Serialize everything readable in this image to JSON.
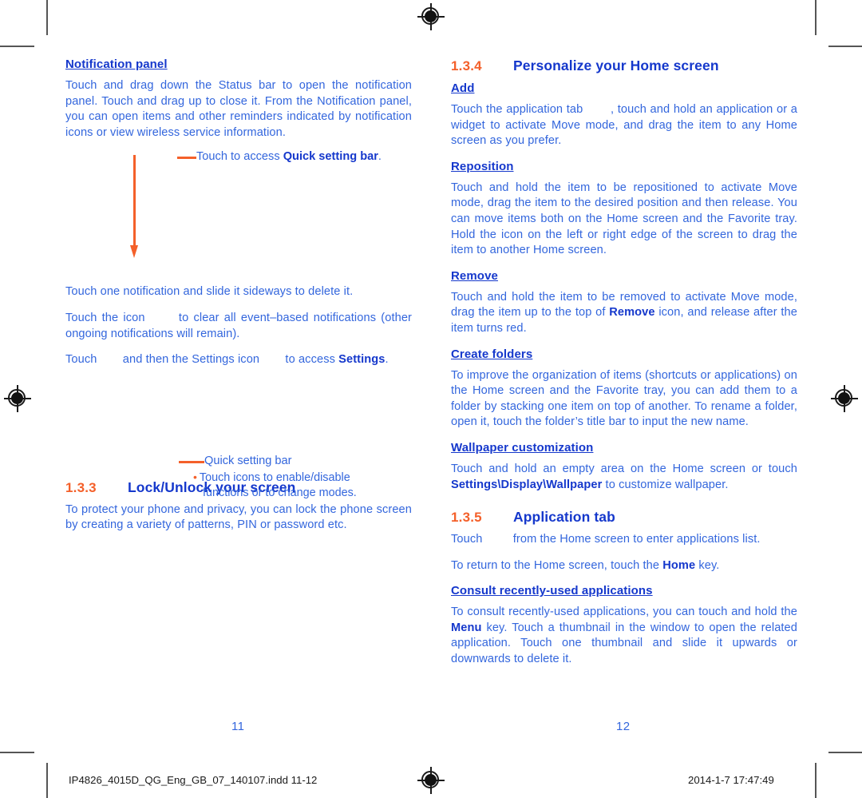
{
  "document": {
    "left_page_number": "11",
    "right_page_number": "12",
    "colors": {
      "body_blue": "#3366dd",
      "heading_blue": "#1538cc",
      "accent_orange": "#f4602a",
      "slug_black": "#1a1a1a"
    }
  },
  "left_column": {
    "notification_panel": {
      "heading": "Notification panel",
      "paragraph": "Touch and drag down the Status bar to open the notification panel. Touch and drag up to close it. From the Notification panel, you can open items and other reminders indicated by notification icons or view wireless service information."
    },
    "callout_quick_setting": {
      "text_before": "Touch to access ",
      "text_bold": "Quick setting bar",
      "text_after": "."
    },
    "paragraphs": {
      "delete_notification": "Touch one notification and slide it sideways to delete it.",
      "clear_events_before": "Touch the icon ",
      "clear_events_after": " to clear all event–based notifications (other ongoing notifications will remain).",
      "settings_before": "Touch ",
      "settings_middle": " and then the Settings icon ",
      "settings_after": " to access ",
      "settings_bold": "Settings",
      "settings_end": "."
    },
    "callout_quick_setting_bar": {
      "title": "Quick setting bar",
      "bullet": "•",
      "bullet_line_1": "Touch icons to enable/disable",
      "bullet_line_2": "functions or to change modes."
    },
    "section_lock": {
      "number": "1.3.3",
      "title": "Lock/Unlock your screen",
      "paragraph": "To protect your phone and privacy, you can lock the phone screen by creating a variety of patterns, PIN or password etc."
    }
  },
  "right_column": {
    "section_personalize": {
      "number": "1.3.4",
      "title": "Personalize your Home screen"
    },
    "add": {
      "heading": "Add",
      "text_before": "Touch the application tab ",
      "text_after": ", touch and hold an application or a widget to activate Move mode, and drag the item to any Home screen as you prefer."
    },
    "reposition": {
      "heading": "Reposition",
      "paragraph": "Touch and hold the item to be repositioned to activate Move mode, drag the item to the desired position and then release. You can move items both on the Home screen and the Favorite tray. Hold the icon on the left or right edge of the screen to drag the item to another Home screen."
    },
    "remove": {
      "heading": "Remove",
      "text_before": "Touch and hold the item to be removed to activate Move mode, drag the item up to the top of ",
      "text_bold": "Remove",
      "text_after": " icon, and release after the item turns red."
    },
    "create_folders": {
      "heading": "Create folders",
      "paragraph": "To improve the organization of items (shortcuts or applications) on the Home screen and the Favorite tray, you can add them to a folder by stacking one item on top of another. To rename a folder, open it, touch the folder’s title bar to input the new name."
    },
    "wallpaper": {
      "heading": "Wallpaper customization",
      "text_before": "Touch and hold an empty area on the Home screen or touch ",
      "text_bold": "Settings\\Display\\Wallpaper",
      "text_after": " to customize wallpaper."
    },
    "section_app_tab": {
      "number": "1.3.5",
      "title": "Application tab",
      "touch_before": "Touch ",
      "touch_after": " from the Home screen to enter applications list.",
      "return_before": "To return to the Home screen, touch the ",
      "return_bold": "Home",
      "return_after": " key."
    },
    "recent_apps": {
      "heading": "Consult recently-used applications",
      "text_before": "To consult recently-used applications, you can touch and hold the ",
      "text_bold": "Menu",
      "text_after": " key. Touch a thumbnail in the window to open the related application. Touch one thumbnail and slide it upwards or downwards to delete it."
    }
  },
  "footer": {
    "file_name": "IP4826_4015D_QG_Eng_GB_07_140107.indd   11-12",
    "timestamp": "2014-1-7   17:47:49"
  }
}
